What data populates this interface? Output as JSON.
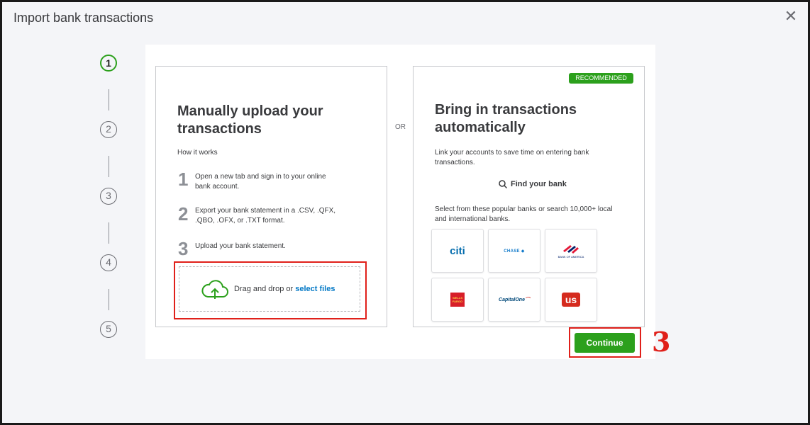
{
  "dialog": {
    "title": "Import bank transactions",
    "close_icon": "close-icon"
  },
  "stepper": {
    "steps": [
      "1",
      "2",
      "3",
      "4",
      "5"
    ],
    "active_step": 1
  },
  "manual": {
    "heading_line1": "Manually upload your",
    "heading_line2": "transactions",
    "how_it_works": "How it works",
    "steps": [
      {
        "num": "1",
        "line1": "Open a new tab and sign in to your online",
        "line2": "bank account."
      },
      {
        "num": "2",
        "line1": "Export your bank statement in a .CSV, .QFX,",
        "line2": ".QBO, .OFX, or .TXT format."
      },
      {
        "num": "3",
        "line1": "Upload your bank statement.",
        "line2": ""
      }
    ],
    "drop_text": "Drag and drop or ",
    "drop_link": "select files",
    "drop_icon": "cloud-upload-icon"
  },
  "or_label": "OR",
  "automatic": {
    "badge": "RECOMMENDED",
    "heading_line1": "Bring in transactions",
    "heading_line2": "automatically",
    "desc_line1": "Link your accounts to save time on entering bank",
    "desc_line2": "transactions.",
    "find_bank": "Find your bank",
    "select_line1": "Select from these popular banks or search 10,000+ local",
    "select_line2": "and international banks.",
    "banks": {
      "citi": "citi",
      "chase": "CHASE",
      "bofa": "BANK OF AMERICA",
      "wells_fargo_line1": "WELLS",
      "wells_fargo_line2": "FARGO",
      "capital_one": "CapitalOne",
      "us_bank": "us"
    }
  },
  "footer": {
    "continue_label": "Continue"
  },
  "annotation": {
    "number": "3",
    "color": "#e0201a"
  },
  "colors": {
    "accent_green": "#2ca01c",
    "link_blue": "#0077c5",
    "highlight_red": "#e0201a"
  }
}
